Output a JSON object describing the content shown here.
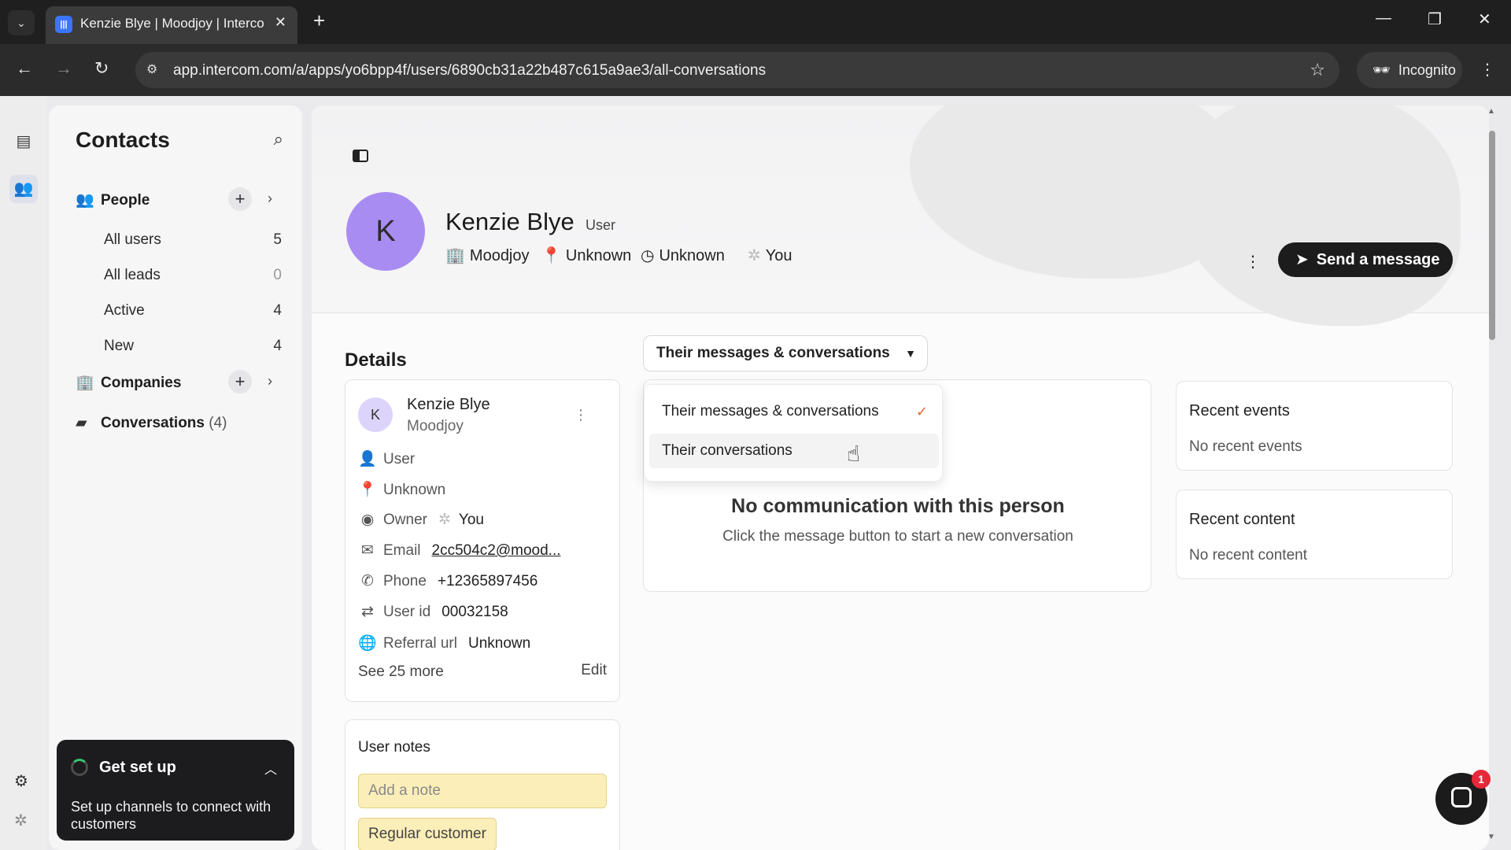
{
  "browser": {
    "tab_title": "Kenzie Blye | Moodjoy | Interco",
    "url": "app.intercom.com/a/apps/yo6bpp4f/users/6890cb31a22b487c615a9ae3/all-conversations",
    "incognito_label": "Incognito"
  },
  "sidebar": {
    "title": "Contacts",
    "people_label": "People",
    "people_items": [
      {
        "label": "All users",
        "count": "5"
      },
      {
        "label": "All leads",
        "count": "0"
      },
      {
        "label": "Active",
        "count": "4"
      },
      {
        "label": "New",
        "count": "4"
      }
    ],
    "companies_label": "Companies",
    "conversations_label": "Conversations",
    "conversations_count": "(4)"
  },
  "get_set_up": {
    "title": "Get set up",
    "description": "Set up channels to connect with customers"
  },
  "profile": {
    "initial": "K",
    "name": "Kenzie Blye",
    "type": "User",
    "company": "Moodjoy",
    "location": "Unknown",
    "time": "Unknown",
    "owner": "You",
    "send_button": "Send a message"
  },
  "details": {
    "heading": "Details",
    "initial": "K",
    "name": "Kenzie Blye",
    "company": "Moodjoy",
    "rows": {
      "type": "User",
      "location": "Unknown",
      "owner_label": "Owner",
      "owner_value": "You",
      "email_label": "Email",
      "email_value": "2cc504c2@mood...",
      "phone_label": "Phone",
      "phone_value": "+12365897456",
      "userid_label": "User id",
      "userid_value": "00032158",
      "referral_label": "Referral url",
      "referral_value": "Unknown"
    },
    "see_more": "See 25 more",
    "edit": "Edit"
  },
  "notes": {
    "heading": "User notes",
    "placeholder": "Add a note",
    "tag": "Regular customer"
  },
  "filter": {
    "selected": "Their messages & conversations",
    "options": [
      "Their messages & conversations",
      "Their conversations"
    ]
  },
  "communication": {
    "title": "No communication with this person",
    "subtitle": "Click the message button to start a new conversation"
  },
  "recent_events": {
    "heading": "Recent events",
    "value": "No recent events"
  },
  "recent_content": {
    "heading": "Recent content",
    "value": "No recent content"
  },
  "messenger": {
    "badge": "1"
  },
  "colors": {
    "accent_check": "#e8633a",
    "avatar": "#a98cf2",
    "note_yellow": "#fbeeb8",
    "badge_red": "#e8283a"
  }
}
